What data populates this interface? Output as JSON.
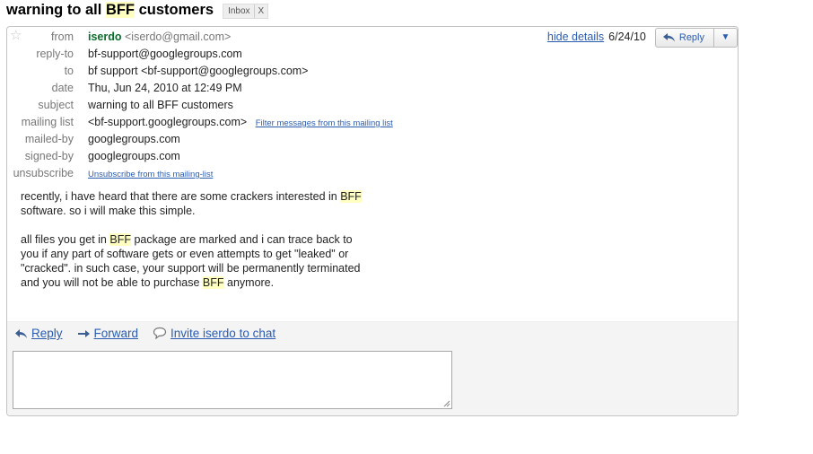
{
  "subject": {
    "prefix": "warning to all ",
    "highlight": "BFF",
    "suffix": " customers"
  },
  "labels": {
    "inbox": "Inbox",
    "remove": "X"
  },
  "header": {
    "hide_details": "hide details",
    "date_short": "6/24/10",
    "reply_label": "Reply",
    "dropdown_icon": "triangle-down"
  },
  "meta": {
    "from": {
      "label": "from",
      "name": "iserdo",
      "address": "<iserdo@gmail.com>"
    },
    "reply_to": {
      "label": "reply-to",
      "value": "bf-support@googlegroups.com"
    },
    "to": {
      "label": "to",
      "value": "bf support <bf-support@googlegroups.com>"
    },
    "date": {
      "label": "date",
      "value": "Thu, Jun 24, 2010 at 12:49 PM"
    },
    "subject": {
      "label": "subject",
      "value": "warning to all BFF customers"
    },
    "mailing_list": {
      "label": "mailing list",
      "value": "<bf-support.googlegroups.com>",
      "link": "Filter messages from this mailing list"
    },
    "mailed_by": {
      "label": "mailed-by",
      "value": "googlegroups.com"
    },
    "signed_by": {
      "label": "signed-by",
      "value": "googlegroups.com"
    },
    "unsubscribe": {
      "label": "unsubscribe",
      "link": "Unsubscribe from this mailing-list"
    }
  },
  "body": {
    "p1": {
      "l1a": "recently, i have heard that there are some crackers interested in ",
      "l1b": "BFF",
      "l2": "software. so i will make this simple."
    },
    "p2": {
      "l1a": "all files you get in ",
      "l1b": "BFF",
      "l1c": " package are marked and i can trace back to",
      "l2": "you if any part of software gets or even attempts to get \"leaked\" or",
      "l3": "\"cracked\". in such case, your support will be permanently terminated",
      "l4a": "and you will not be able to purchase ",
      "l4b": "BFF",
      "l4c": " anymore."
    }
  },
  "actions": {
    "reply": "Reply",
    "forward": "Forward",
    "invite": "Invite iserdo to chat"
  },
  "colors": {
    "link": "#2a5db0",
    "sender": "#0a6e2b",
    "highlight": "#ffffc2",
    "action_bg": "#f4f4f4"
  }
}
